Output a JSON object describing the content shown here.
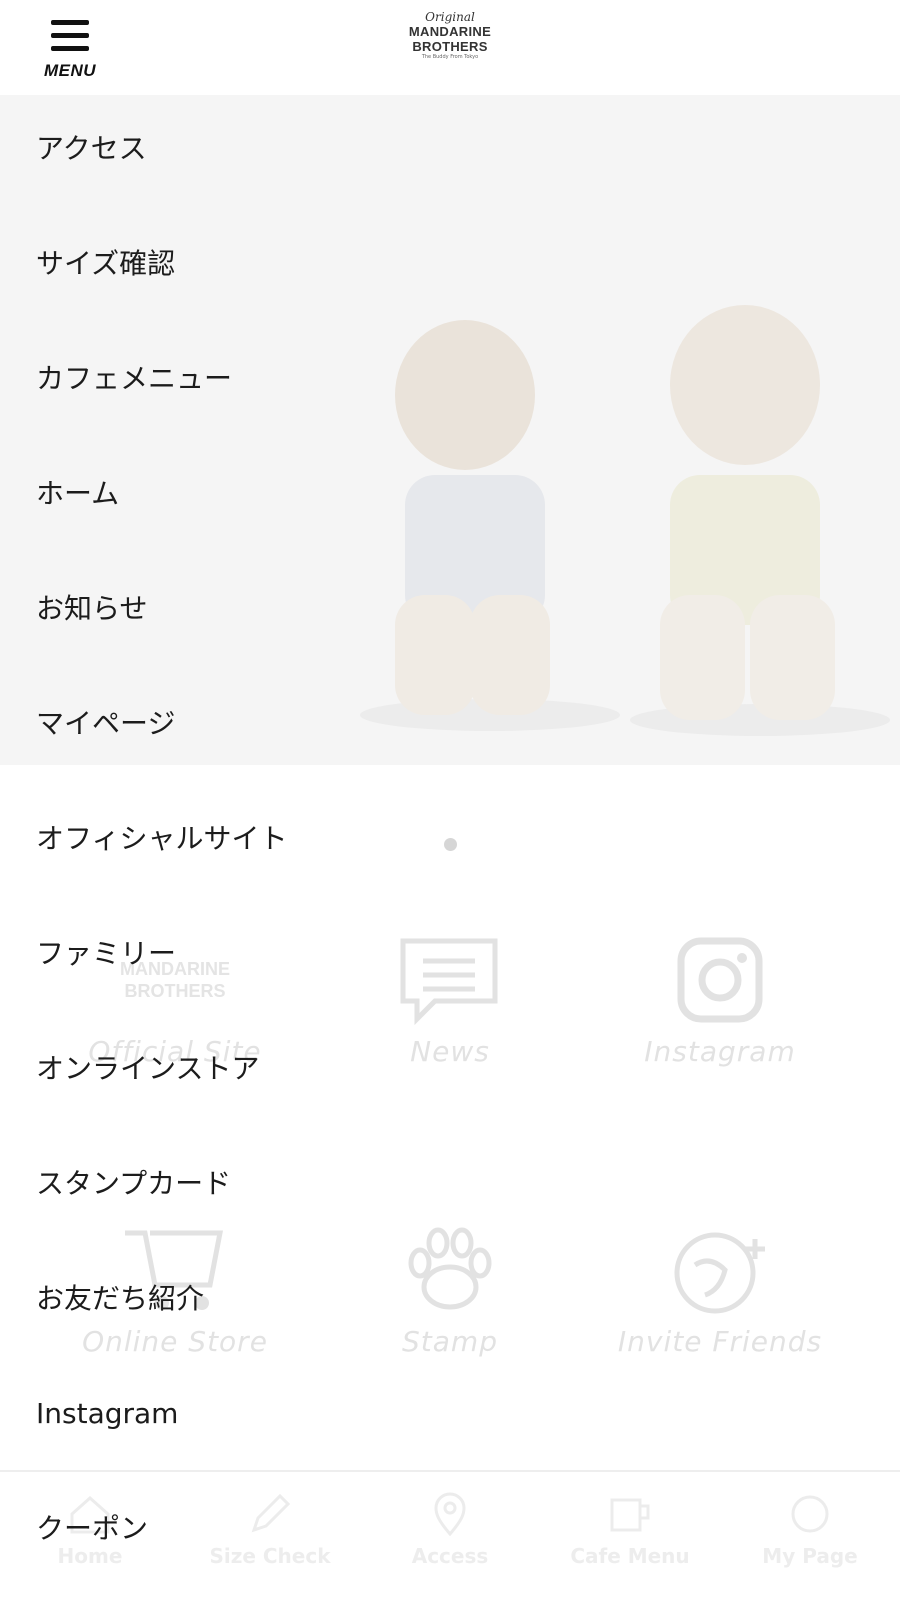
{
  "header": {
    "menu_label": "MENU",
    "logo": {
      "script": "Original",
      "line1": "MANDARINE",
      "line2": "BROTHERS",
      "tagline": "The Buddy From Tokyo"
    }
  },
  "menu": {
    "items": [
      {
        "label": "アクセス"
      },
      {
        "label": "サイズ確認"
      },
      {
        "label": "カフェメニュー"
      },
      {
        "label": "ホーム"
      },
      {
        "label": "お知らせ"
      },
      {
        "label": "マイページ"
      },
      {
        "label": "オフィシャルサイト"
      },
      {
        "label": "ファミリー"
      },
      {
        "label": "オンラインストア"
      },
      {
        "label": "スタンプカード"
      },
      {
        "label": "お友だち紹介"
      },
      {
        "label": "Instagram"
      },
      {
        "label": "クーポン"
      }
    ]
  },
  "background": {
    "tiles": [
      {
        "label": "Official Site",
        "icon": "logo-icon"
      },
      {
        "label": "News",
        "icon": "speech-bubble-icon"
      },
      {
        "label": "Instagram",
        "icon": "instagram-icon"
      },
      {
        "label": "Online Store",
        "icon": "cart-icon"
      },
      {
        "label": "Stamp",
        "icon": "paw-icon"
      },
      {
        "label": "Invite Friends",
        "icon": "dog-plus-icon"
      }
    ],
    "tabs": [
      {
        "label": "Home",
        "icon": "home-icon"
      },
      {
        "label": "Size Check",
        "icon": "pencil-icon"
      },
      {
        "label": "Access",
        "icon": "map-pin-icon"
      },
      {
        "label": "Cafe Menu",
        "icon": "cup-icon"
      },
      {
        "label": "My Page",
        "icon": "dog-icon"
      }
    ]
  },
  "colors": {
    "menu_text": "#1c1c1c",
    "faded_content": "#e2e2e2",
    "background": "#ffffff"
  }
}
